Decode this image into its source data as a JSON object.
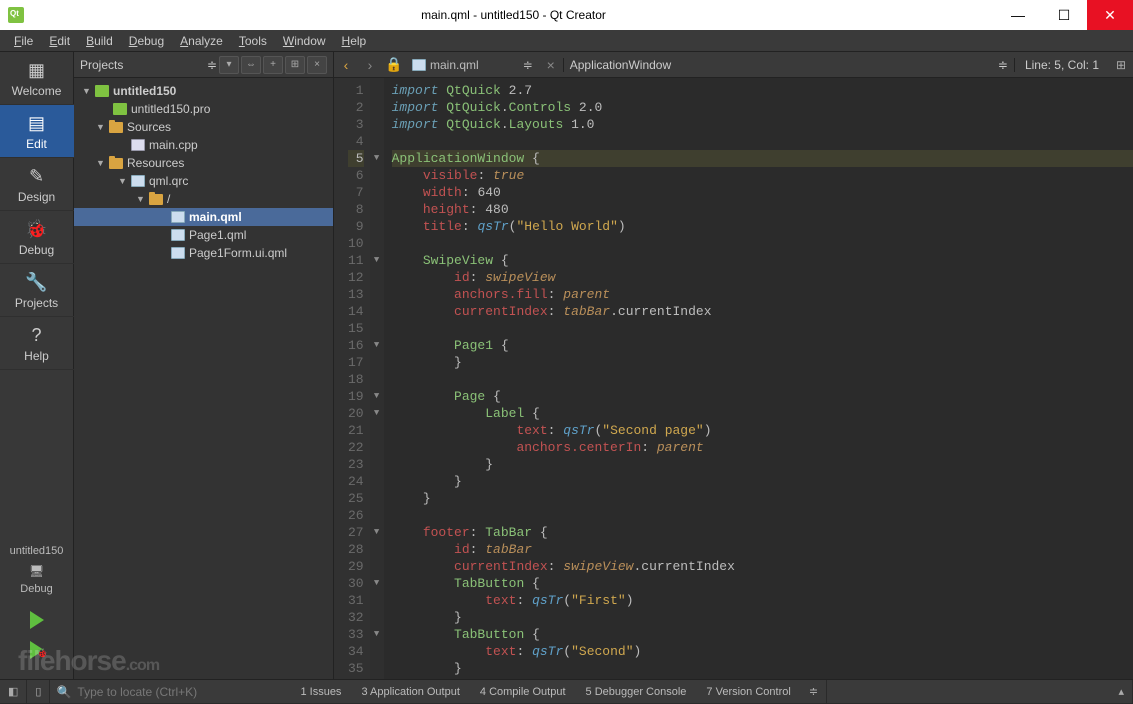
{
  "window": {
    "title": "main.qml - untitled150 - Qt Creator"
  },
  "menus": [
    "File",
    "Edit",
    "Build",
    "Debug",
    "Analyze",
    "Tools",
    "Window",
    "Help"
  ],
  "modes": [
    {
      "label": "Welcome",
      "icon": "▦"
    },
    {
      "label": "Edit",
      "icon": "▤",
      "active": true
    },
    {
      "label": "Design",
      "icon": "✎"
    },
    {
      "label": "Debug",
      "icon": "🐞"
    },
    {
      "label": "Projects",
      "icon": "🔧"
    },
    {
      "label": "Help",
      "icon": "?"
    }
  ],
  "run": {
    "project": "untitled150",
    "config": "Debug"
  },
  "projects_panel": {
    "selector": "Projects",
    "tree": [
      {
        "ind": 8,
        "exp": "▼",
        "icon": "prj",
        "label": "untitled150",
        "bold": true
      },
      {
        "ind": 26,
        "exp": "",
        "icon": "prj",
        "label": "untitled150.pro"
      },
      {
        "ind": 22,
        "exp": "▼",
        "icon": "folder",
        "label": "Sources"
      },
      {
        "ind": 44,
        "exp": "",
        "icon": "cpp",
        "label": "main.cpp"
      },
      {
        "ind": 22,
        "exp": "▼",
        "icon": "folder",
        "label": "Resources"
      },
      {
        "ind": 44,
        "exp": "▼",
        "icon": "qml",
        "label": "qml.qrc"
      },
      {
        "ind": 62,
        "exp": "▼",
        "icon": "folder",
        "label": "/"
      },
      {
        "ind": 84,
        "exp": "",
        "icon": "qml",
        "label": "main.qml",
        "bold": true,
        "sel": true
      },
      {
        "ind": 84,
        "exp": "",
        "icon": "qml",
        "label": "Page1.qml"
      },
      {
        "ind": 84,
        "exp": "",
        "icon": "qml",
        "label": "Page1Form.ui.qml"
      }
    ]
  },
  "editor_bar": {
    "file": "main.qml",
    "crumb": "ApplicationWindow",
    "pos": "Line: 5, Col: 1"
  },
  "code": {
    "highlight_line": 5,
    "lines": [
      {
        "n": 1,
        "fold": "",
        "tokens": [
          [
            "kw",
            "import"
          ],
          [
            "punct",
            " "
          ],
          [
            "type",
            "QtQuick"
          ],
          [
            "punct",
            " "
          ],
          [
            "num",
            "2.7"
          ]
        ]
      },
      {
        "n": 2,
        "fold": "",
        "tokens": [
          [
            "kw",
            "import"
          ],
          [
            "punct",
            " "
          ],
          [
            "type",
            "QtQuick"
          ],
          [
            "dot",
            "."
          ],
          [
            "type",
            "Controls"
          ],
          [
            "punct",
            " "
          ],
          [
            "num",
            "2.0"
          ]
        ]
      },
      {
        "n": 3,
        "fold": "",
        "tokens": [
          [
            "kw",
            "import"
          ],
          [
            "punct",
            " "
          ],
          [
            "type",
            "QtQuick"
          ],
          [
            "dot",
            "."
          ],
          [
            "type",
            "Layouts"
          ],
          [
            "punct",
            " "
          ],
          [
            "num",
            "1.0"
          ]
        ]
      },
      {
        "n": 4,
        "fold": "",
        "tokens": []
      },
      {
        "n": 5,
        "fold": "▼",
        "tokens": [
          [
            "type",
            "ApplicationWindow"
          ],
          [
            "punct",
            " {"
          ]
        ]
      },
      {
        "n": 6,
        "fold": "",
        "tokens": [
          [
            "punct",
            "    "
          ],
          [
            "prop",
            "visible"
          ],
          [
            "punct",
            ": "
          ],
          [
            "val",
            "true"
          ]
        ]
      },
      {
        "n": 7,
        "fold": "",
        "tokens": [
          [
            "punct",
            "    "
          ],
          [
            "prop",
            "width"
          ],
          [
            "punct",
            ": "
          ],
          [
            "num",
            "640"
          ]
        ]
      },
      {
        "n": 8,
        "fold": "",
        "tokens": [
          [
            "punct",
            "    "
          ],
          [
            "prop",
            "height"
          ],
          [
            "punct",
            ": "
          ],
          [
            "num",
            "480"
          ]
        ]
      },
      {
        "n": 9,
        "fold": "",
        "tokens": [
          [
            "punct",
            "    "
          ],
          [
            "prop",
            "title"
          ],
          [
            "punct",
            ": "
          ],
          [
            "func",
            "qsTr"
          ],
          [
            "punct",
            "("
          ],
          [
            "str",
            "\"Hello World\""
          ],
          [
            "punct",
            ")"
          ]
        ]
      },
      {
        "n": 10,
        "fold": "",
        "tokens": []
      },
      {
        "n": 11,
        "fold": "▼",
        "tokens": [
          [
            "punct",
            "    "
          ],
          [
            "type",
            "SwipeView"
          ],
          [
            "punct",
            " {"
          ]
        ]
      },
      {
        "n": 12,
        "fold": "",
        "tokens": [
          [
            "punct",
            "        "
          ],
          [
            "prop",
            "id"
          ],
          [
            "punct",
            ": "
          ],
          [
            "ident",
            "swipeView"
          ]
        ]
      },
      {
        "n": 13,
        "fold": "",
        "tokens": [
          [
            "punct",
            "        "
          ],
          [
            "prop",
            "anchors.fill"
          ],
          [
            "punct",
            ": "
          ],
          [
            "ident",
            "parent"
          ]
        ]
      },
      {
        "n": 14,
        "fold": "",
        "tokens": [
          [
            "punct",
            "        "
          ],
          [
            "prop",
            "currentIndex"
          ],
          [
            "punct",
            ": "
          ],
          [
            "ident",
            "tabBar"
          ],
          [
            "dot",
            "."
          ],
          [
            "punct",
            "currentIndex"
          ]
        ]
      },
      {
        "n": 15,
        "fold": "",
        "tokens": []
      },
      {
        "n": 16,
        "fold": "▼",
        "tokens": [
          [
            "punct",
            "        "
          ],
          [
            "type",
            "Page1"
          ],
          [
            "punct",
            " {"
          ]
        ]
      },
      {
        "n": 17,
        "fold": "",
        "tokens": [
          [
            "punct",
            "        }"
          ]
        ]
      },
      {
        "n": 18,
        "fold": "",
        "tokens": []
      },
      {
        "n": 19,
        "fold": "▼",
        "tokens": [
          [
            "punct",
            "        "
          ],
          [
            "type",
            "Page"
          ],
          [
            "punct",
            " {"
          ]
        ]
      },
      {
        "n": 20,
        "fold": "▼",
        "tokens": [
          [
            "punct",
            "            "
          ],
          [
            "type",
            "Label"
          ],
          [
            "punct",
            " {"
          ]
        ]
      },
      {
        "n": 21,
        "fold": "",
        "tokens": [
          [
            "punct",
            "                "
          ],
          [
            "prop",
            "text"
          ],
          [
            "punct",
            ": "
          ],
          [
            "func",
            "qsTr"
          ],
          [
            "punct",
            "("
          ],
          [
            "str",
            "\"Second page\""
          ],
          [
            "punct",
            ")"
          ]
        ]
      },
      {
        "n": 22,
        "fold": "",
        "tokens": [
          [
            "punct",
            "                "
          ],
          [
            "prop",
            "anchors.centerIn"
          ],
          [
            "punct",
            ": "
          ],
          [
            "ident",
            "parent"
          ]
        ]
      },
      {
        "n": 23,
        "fold": "",
        "tokens": [
          [
            "punct",
            "            }"
          ]
        ]
      },
      {
        "n": 24,
        "fold": "",
        "tokens": [
          [
            "punct",
            "        }"
          ]
        ]
      },
      {
        "n": 25,
        "fold": "",
        "tokens": [
          [
            "punct",
            "    }"
          ]
        ]
      },
      {
        "n": 26,
        "fold": "",
        "tokens": []
      },
      {
        "n": 27,
        "fold": "▼",
        "tokens": [
          [
            "punct",
            "    "
          ],
          [
            "prop",
            "footer"
          ],
          [
            "punct",
            ": "
          ],
          [
            "type",
            "TabBar"
          ],
          [
            "punct",
            " {"
          ]
        ]
      },
      {
        "n": 28,
        "fold": "",
        "tokens": [
          [
            "punct",
            "        "
          ],
          [
            "prop",
            "id"
          ],
          [
            "punct",
            ": "
          ],
          [
            "ident",
            "tabBar"
          ]
        ]
      },
      {
        "n": 29,
        "fold": "",
        "tokens": [
          [
            "punct",
            "        "
          ],
          [
            "prop",
            "currentIndex"
          ],
          [
            "punct",
            ": "
          ],
          [
            "ident",
            "swipeView"
          ],
          [
            "dot",
            "."
          ],
          [
            "punct",
            "currentIndex"
          ]
        ]
      },
      {
        "n": 30,
        "fold": "▼",
        "tokens": [
          [
            "punct",
            "        "
          ],
          [
            "type",
            "TabButton"
          ],
          [
            "punct",
            " {"
          ]
        ]
      },
      {
        "n": 31,
        "fold": "",
        "tokens": [
          [
            "punct",
            "            "
          ],
          [
            "prop",
            "text"
          ],
          [
            "punct",
            ": "
          ],
          [
            "func",
            "qsTr"
          ],
          [
            "punct",
            "("
          ],
          [
            "str",
            "\"First\""
          ],
          [
            "punct",
            ")"
          ]
        ]
      },
      {
        "n": 32,
        "fold": "",
        "tokens": [
          [
            "punct",
            "        }"
          ]
        ]
      },
      {
        "n": 33,
        "fold": "▼",
        "tokens": [
          [
            "punct",
            "        "
          ],
          [
            "type",
            "TabButton"
          ],
          [
            "punct",
            " {"
          ]
        ]
      },
      {
        "n": 34,
        "fold": "",
        "tokens": [
          [
            "punct",
            "            "
          ],
          [
            "prop",
            "text"
          ],
          [
            "punct",
            ": "
          ],
          [
            "func",
            "qsTr"
          ],
          [
            "punct",
            "("
          ],
          [
            "str",
            "\"Second\""
          ],
          [
            "punct",
            ")"
          ]
        ]
      },
      {
        "n": 35,
        "fold": "",
        "tokens": [
          [
            "punct",
            "        }"
          ]
        ]
      }
    ]
  },
  "statusbar": {
    "search_placeholder": "Type to locate (Ctrl+K)",
    "outputs": [
      "1  Issues",
      "3  Application Output",
      "4  Compile Output",
      "5  Debugger Console",
      "7  Version Control"
    ]
  },
  "watermark": {
    "text": "filehorse",
    "suffix": ".com"
  }
}
